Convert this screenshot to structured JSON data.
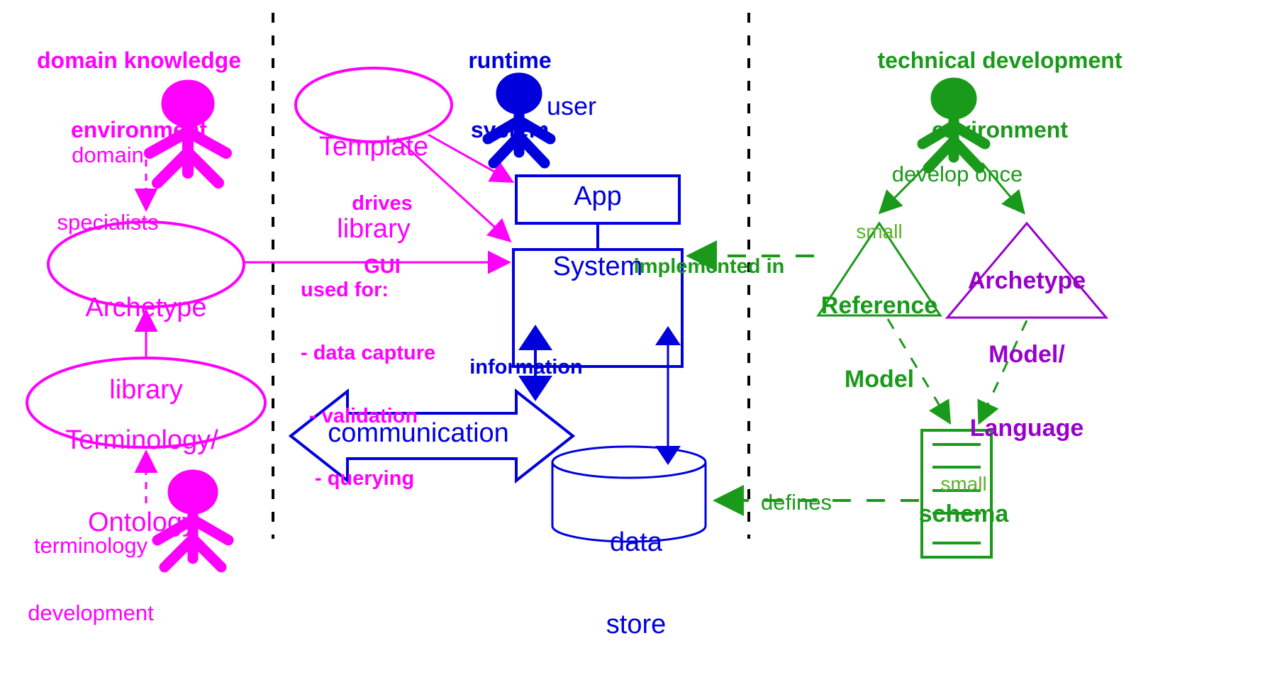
{
  "colors": {
    "magenta": "#ff00ff",
    "blue": "#0000dd",
    "green": "#1a9a1a",
    "light_green": "#44aa22",
    "purple": "#9900cc",
    "divider": "#000000",
    "background": "#ffffff"
  },
  "zones": {
    "left": {
      "title_line1": "domain knowledge",
      "title_line2": "environment"
    },
    "center": {
      "title_line1": "runtime",
      "title_line2": "system"
    },
    "right": {
      "title_line1": "technical development",
      "title_line2": "environment"
    }
  },
  "left_zone": {
    "actor_top_label_line1": "domain",
    "actor_top_label_line2": "specialists",
    "ellipse_archetype_line1": "Archetype",
    "ellipse_archetype_line2": "library",
    "ellipse_terminology_line1": "Terminology/",
    "ellipse_terminology_line2": "Ontology",
    "actor_bottom_label_line1": "terminology",
    "actor_bottom_label_line2": "development"
  },
  "center_zone": {
    "ellipse_template_line1": "Template",
    "ellipse_template_line2": "library",
    "drives_gui_line1": "drives",
    "drives_gui_line2": "GUI",
    "user_label": "user",
    "app_box": "App",
    "system_box": "System",
    "used_for_line1": "used for:",
    "used_for_line2": "- data capture",
    "used_for_line3": "- validation",
    "used_for_line4": "- querying",
    "information_label": "information",
    "communication_label": "communication",
    "data_store_line1": "data",
    "data_store_line2": "store"
  },
  "right_zone": {
    "develop_once_label": "develop once",
    "reference_model_small": "small",
    "reference_model_line1": "Reference",
    "reference_model_line2": "Model",
    "archetype_model_line1": "Archetype",
    "archetype_model_line2": "Model/",
    "archetype_model_line3": "Language",
    "schema_small": "small",
    "schema_label": "schema",
    "implemented_in_label": "implemented in",
    "defines_label": "defines"
  },
  "icons": {
    "actor_domain_specialists": "stick-figure-icon",
    "actor_terminology_developer": "stick-figure-icon",
    "actor_user": "stick-figure-icon",
    "actor_developer": "stick-figure-icon",
    "data_store": "cylinder-database-icon",
    "communication": "double-arrow-icon",
    "reference_model": "triangle-icon",
    "archetype_model": "triangle-icon",
    "schema": "document-lines-icon"
  }
}
